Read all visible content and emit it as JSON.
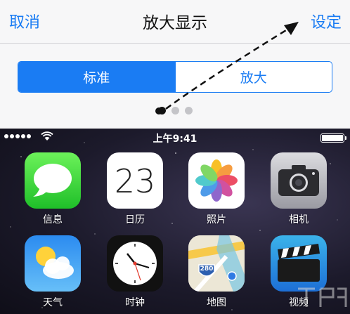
{
  "nav": {
    "cancel": "取消",
    "title": "放大显示",
    "set": "设定"
  },
  "segment": {
    "options": [
      "标准",
      "放大"
    ],
    "selected": 0
  },
  "page_dots": {
    "count": 3,
    "active": 0
  },
  "status_bar": {
    "time": "上午9:41"
  },
  "apps": [
    {
      "label": "信息",
      "icon": "messages-icon"
    },
    {
      "label": "日历",
      "icon": "calendar-icon",
      "day": "23"
    },
    {
      "label": "照片",
      "icon": "photos-icon"
    },
    {
      "label": "相机",
      "icon": "camera-icon"
    },
    {
      "label": "天气",
      "icon": "weather-icon"
    },
    {
      "label": "时钟",
      "icon": "clock-icon"
    },
    {
      "label": "地图",
      "icon": "maps-icon",
      "route": "280"
    },
    {
      "label": "视频",
      "icon": "videos-icon"
    }
  ],
  "colors": {
    "accent": "#1a7cf3",
    "messages": "#35d63f",
    "weather": "#3b98f2"
  }
}
